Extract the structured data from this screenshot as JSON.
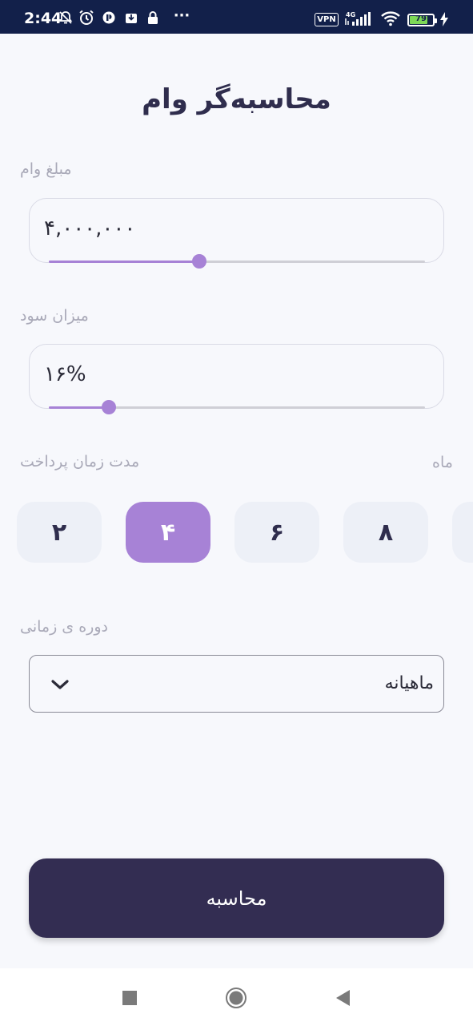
{
  "status_bar": {
    "time": "2:44",
    "dots": "···",
    "vpn": "VPN",
    "network": "4G",
    "battery": "79",
    "icons": [
      "notifications-off-icon",
      "alarm-icon",
      "app-icon",
      "download-icon",
      "lock-icon",
      "signal-icon",
      "wifi-icon",
      "charging-icon"
    ]
  },
  "title": "محاسبه‌گر وام",
  "loan_amount": {
    "label": "مبلغ وام",
    "value": "۴,۰۰۰,۰۰۰",
    "slider_fraction": 0.4
  },
  "interest": {
    "label": "میزان سود",
    "value": "۱۶%",
    "slider_fraction": 0.16
  },
  "duration": {
    "label": "مدت زمان پرداخت",
    "unit": "ماه",
    "options": [
      "۲",
      "۴",
      "۶",
      "۸"
    ],
    "selected": "۴"
  },
  "period": {
    "label": "دوره ی زمانی",
    "selected": "ماهیانه"
  },
  "calculate_button": "محاسبه",
  "colors": {
    "accent": "#a782d6",
    "primary_dark": "#332d52",
    "status_bar": "#12204a",
    "background": "#f7f8fc"
  }
}
